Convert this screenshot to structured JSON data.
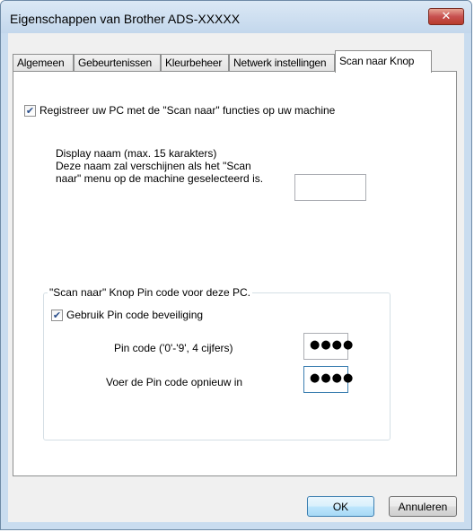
{
  "window": {
    "title": "Eigenschappen van Brother ADS-XXXXX",
    "close_glyph": "✕"
  },
  "tabs": [
    {
      "label": "Algemeen",
      "active": false
    },
    {
      "label": "Gebeurtenissen",
      "active": false
    },
    {
      "label": "Kleurbeheer",
      "active": false
    },
    {
      "label": "Netwerk instellingen",
      "active": false
    },
    {
      "label": "Scan naar Knop",
      "active": true
    }
  ],
  "scan_tab": {
    "register_checkbox": {
      "checked": true,
      "mark": "✔",
      "label": "Registreer uw PC met de \"Scan naar\" functies op uw machine"
    },
    "display_name": {
      "line1": "Display naam (max. 15 karakters)",
      "line2": "Deze naam zal verschijnen als het \"Scan",
      "line3": "naar\" menu op de machine geselecteerd is.",
      "value": ""
    },
    "pin_group": {
      "legend": "\"Scan naar\" Knop Pin code voor deze PC.",
      "use_pin_checkbox": {
        "checked": true,
        "mark": "✔",
        "label": "Gebruik Pin code beveiliging"
      },
      "pin_label": "Pin code ('0'-'9', 4 cijfers)",
      "pin_value": "●●●●",
      "pin_repeat_label": "Voer de Pin code opnieuw in",
      "pin_repeat_value": "●●●●"
    }
  },
  "buttons": {
    "ok": "OK",
    "cancel": "Annuleren"
  },
  "colors": {
    "frame": "#c9dcef",
    "close_button": "#c75050",
    "default_button_border": "#3c7fb1",
    "checkmark": "#2b4f8c"
  }
}
